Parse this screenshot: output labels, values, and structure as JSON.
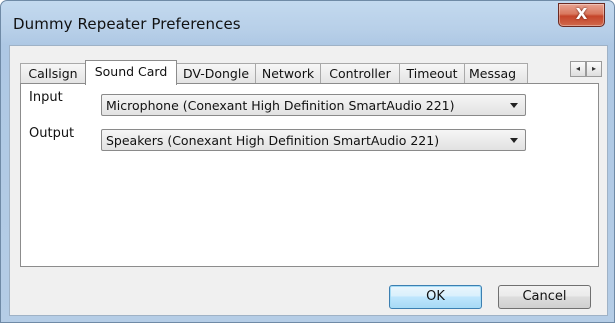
{
  "window": {
    "title": "Dummy Repeater Preferences",
    "close_label": "X"
  },
  "tabs": [
    {
      "label": "Callsign",
      "active": false
    },
    {
      "label": "Sound Card",
      "active": true
    },
    {
      "label": "DV-Dongle",
      "active": false
    },
    {
      "label": "Network",
      "active": false
    },
    {
      "label": "Controller",
      "active": false
    },
    {
      "label": "Timeout",
      "active": false
    },
    {
      "label": "Messag",
      "active": false
    }
  ],
  "tab_scroll": {
    "left_icon": "◂",
    "right_icon": "▸"
  },
  "sound_card": {
    "input_label": "Input",
    "input_value": "Microphone (Conexant High Definition SmartAudio 221)",
    "output_label": "Output",
    "output_value": "Speakers (Conexant High Definition SmartAudio 221)"
  },
  "buttons": {
    "ok": "OK",
    "cancel": "Cancel"
  }
}
